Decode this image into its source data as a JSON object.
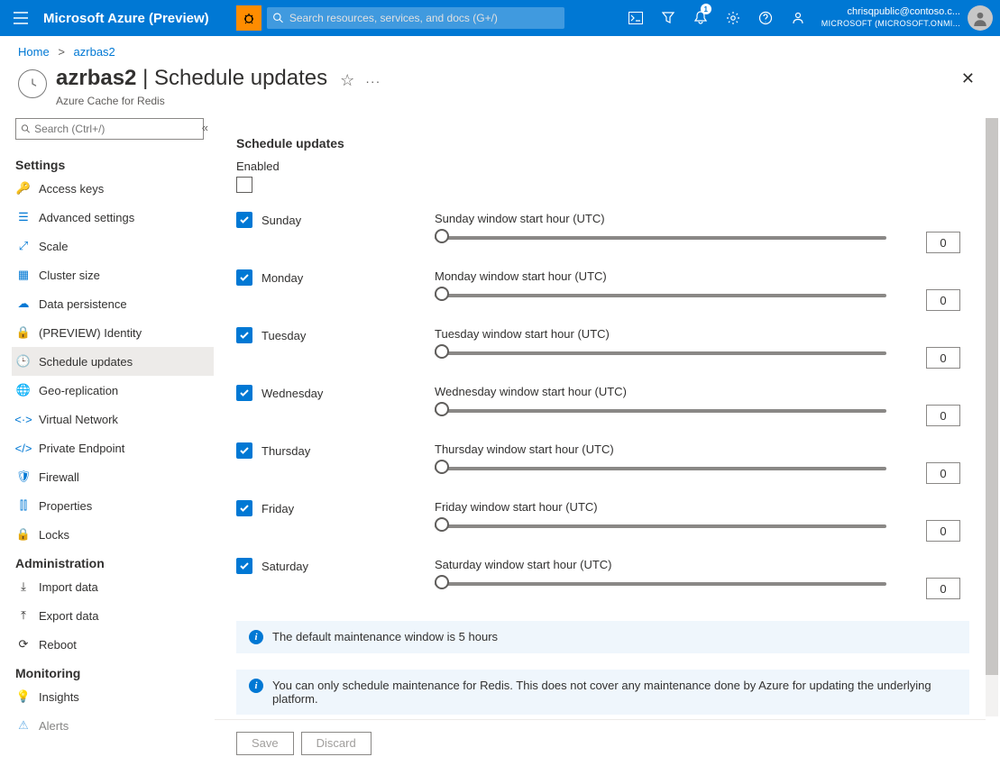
{
  "topbar": {
    "brand": "Microsoft Azure (Preview)",
    "search_placeholder": "Search resources, services, and docs (G+/)",
    "notification_count": "1",
    "user_email": "chrisqpublic@contoso.c...",
    "user_tenant": "MICROSOFT (MICROSOFT.ONMI..."
  },
  "breadcrumb": {
    "home": "Home",
    "current": "azrbas2"
  },
  "page": {
    "resource": "azrbas2",
    "section": "Schedule updates",
    "subtitle": "Azure Cache for Redis"
  },
  "sidebar": {
    "search_placeholder": "Search (Ctrl+/)",
    "sections": {
      "settings": "Settings",
      "administration": "Administration",
      "monitoring": "Monitoring"
    },
    "items": {
      "access_keys": "Access keys",
      "advanced": "Advanced settings",
      "scale": "Scale",
      "cluster": "Cluster size",
      "persistence": "Data persistence",
      "identity": "(PREVIEW) Identity",
      "schedule": "Schedule updates",
      "geo": "Geo-replication",
      "vnet": "Virtual Network",
      "private_ep": "Private Endpoint",
      "firewall": "Firewall",
      "properties": "Properties",
      "locks": "Locks",
      "import": "Import data",
      "export": "Export data",
      "reboot": "Reboot",
      "insights": "Insights",
      "alerts": "Alerts"
    }
  },
  "content": {
    "heading": "Schedule updates",
    "enabled_label": "Enabled",
    "days": [
      {
        "name": "Sunday",
        "label": "Sunday window start hour (UTC)",
        "value": "0"
      },
      {
        "name": "Monday",
        "label": "Monday window start hour (UTC)",
        "value": "0"
      },
      {
        "name": "Tuesday",
        "label": "Tuesday window start hour (UTC)",
        "value": "0"
      },
      {
        "name": "Wednesday",
        "label": "Wednesday window start hour (UTC)",
        "value": "0"
      },
      {
        "name": "Thursday",
        "label": "Thursday window start hour (UTC)",
        "value": "0"
      },
      {
        "name": "Friday",
        "label": "Friday window start hour (UTC)",
        "value": "0"
      },
      {
        "name": "Saturday",
        "label": "Saturday window start hour (UTC)",
        "value": "0"
      }
    ],
    "info1": "The default maintenance window is 5 hours",
    "info2": "You can only schedule maintenance for Redis. This does not cover any maintenance done by Azure for updating the underlying platform.",
    "save": "Save",
    "discard": "Discard"
  }
}
